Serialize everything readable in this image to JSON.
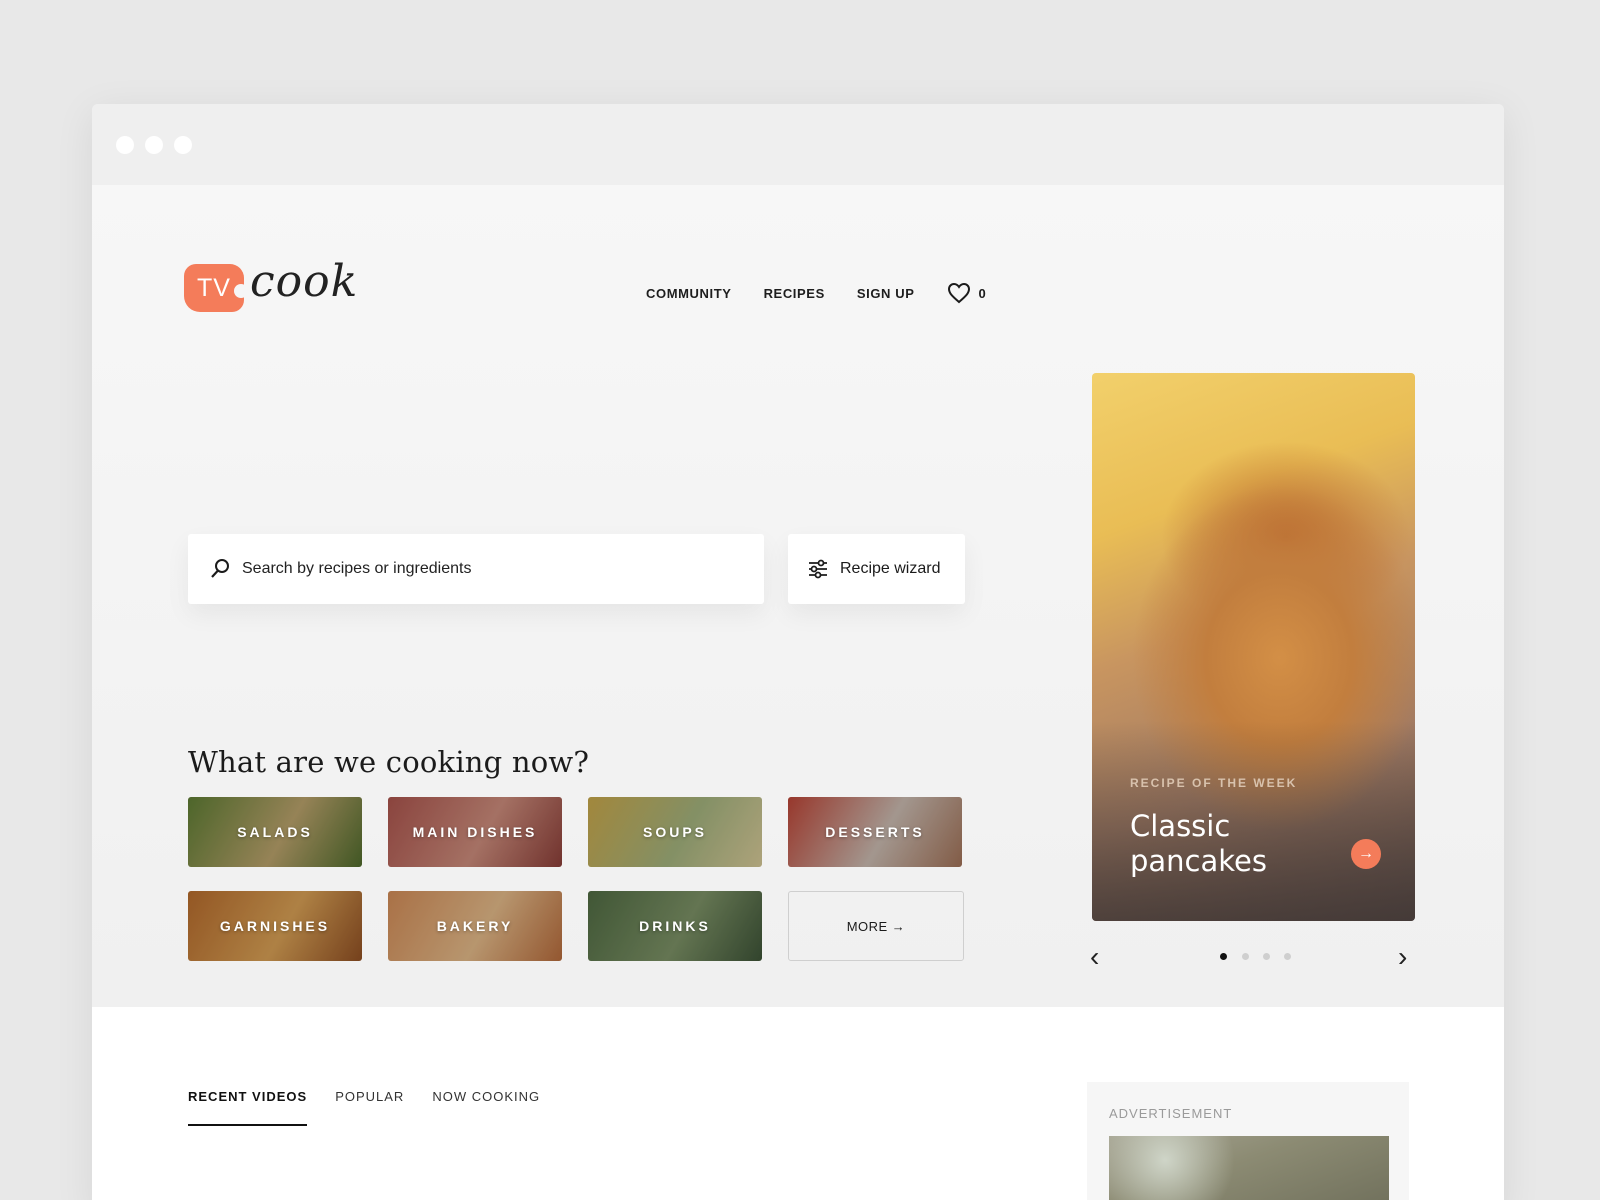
{
  "brand": {
    "badge": "TV",
    "word": "cook"
  },
  "nav": {
    "items": [
      "COMMUNITY",
      "RECIPES",
      "SIGN UP"
    ],
    "favorites_count": "0"
  },
  "search": {
    "placeholder": "Search by recipes or ingredients",
    "wizard_label": "Recipe wizard"
  },
  "section_title": "What are we cooking now?",
  "categories": [
    {
      "label": "SALADS",
      "image": "salad-photo",
      "colors": [
        "#5e7c34",
        "#b7a06a",
        "#4f6a2c"
      ]
    },
    {
      "label": "MAIN DISHES",
      "image": "meat-photo",
      "colors": [
        "#a9534c",
        "#c98a7a",
        "#8a3e38"
      ]
    },
    {
      "label": "SOUPS",
      "image": "soup-photo",
      "colors": [
        "#c6a64a",
        "#a1b07c",
        "#d4c796"
      ]
    },
    {
      "label": "DESSERTS",
      "image": "dessert-photo",
      "colors": [
        "#b94436",
        "#c7b8ae",
        "#9f7056"
      ]
    },
    {
      "label": "GARNISHES",
      "image": "garnish-photo",
      "colors": [
        "#b46a2c",
        "#d59e54",
        "#8f4f23"
      ]
    },
    {
      "label": "BAKERY",
      "image": "pizza-photo",
      "colors": [
        "#cf8a56",
        "#e0b787",
        "#b46a3b"
      ]
    },
    {
      "label": "DRINKS",
      "image": "drink-photo",
      "colors": [
        "#4f6a42",
        "#7a8f64",
        "#3d5337"
      ]
    }
  ],
  "more_label": "MORE →",
  "feature": {
    "label": "RECIPE OF THE WEEK",
    "title": "Classic pancakes",
    "image": "pancakes-photo"
  },
  "carousel": {
    "active_index": 0,
    "dot_count": 4
  },
  "tabs": [
    {
      "label": "RECENT VIDEOS",
      "active": true
    },
    {
      "label": "POPULAR",
      "active": false
    },
    {
      "label": "NOW COOKING",
      "active": false
    }
  ],
  "ad": {
    "label": "ADVERTISEMENT",
    "image": "ad-photo"
  },
  "colors": {
    "accent": "#f47c5a",
    "background": "#f3f3f3"
  }
}
